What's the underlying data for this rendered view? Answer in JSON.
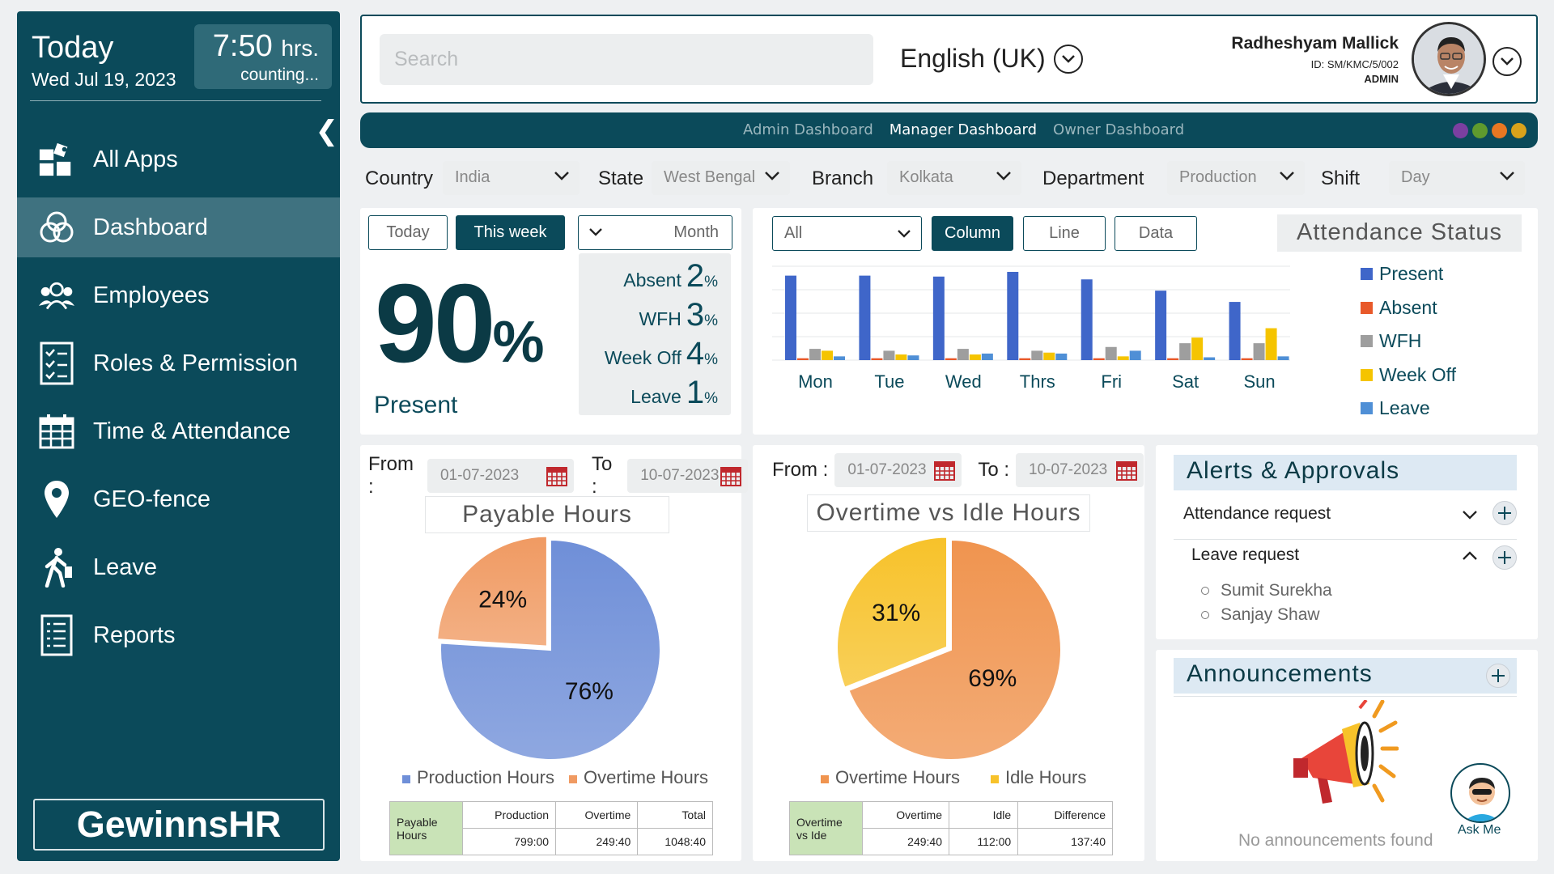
{
  "sidebar": {
    "today_title": "Today",
    "today_date": "Wed Jul 19, 2023",
    "time_value": "7:50",
    "time_unit": "hrs.",
    "time_status": "counting...",
    "collapse_icon": "chevron-left-icon",
    "items": [
      {
        "label": "All Apps",
        "icon": "apps-icon"
      },
      {
        "label": "Dashboard",
        "icon": "dashboard-icon"
      },
      {
        "label": "Employees",
        "icon": "employees-icon"
      },
      {
        "label": "Roles & Permission",
        "icon": "checklist-icon"
      },
      {
        "label": "Time & Attendance",
        "icon": "calendar-icon"
      },
      {
        "label": "GEO-fence",
        "icon": "location-pin-icon"
      },
      {
        "label": "Leave",
        "icon": "walking-person-icon"
      },
      {
        "label": "Reports",
        "icon": "report-icon"
      }
    ],
    "active_item": "Dashboard",
    "brand": "GewinnsHR"
  },
  "header": {
    "search_placeholder": "Search",
    "language": "English (UK)",
    "user_name": "Radheshyam Mallick",
    "user_id": "ID: SM/KMC/5/002",
    "user_role": "ADMIN"
  },
  "tabs": {
    "items": [
      "Admin Dashboard",
      "Manager Dashboard",
      "Owner Dashboard"
    ],
    "active": "Manager Dashboard",
    "theme_dots": [
      "#7b3fa0",
      "#5f9a2e",
      "#e87722",
      "#d9a21b"
    ]
  },
  "filters": {
    "country_label": "Country",
    "country_value": "India",
    "state_label": "State",
    "state_value": "West Bengal",
    "branch_label": "Branch",
    "branch_value": "Kolkata",
    "department_label": "Department",
    "department_value": "Production",
    "shift_label": "Shift",
    "shift_value": "Day"
  },
  "attendance_summary": {
    "btn_today": "Today",
    "btn_week": "This week",
    "btn_month": "Month",
    "present_value": "90",
    "present_unit": "%",
    "present_label": "Present",
    "absent_label": "Absent",
    "absent_value": "2",
    "wfh_label": "WFH",
    "wfh_value": "3",
    "weekoff_label": "Week Off",
    "weekoff_value": "4",
    "leave_label": "Leave",
    "leave_value": "1",
    "pct": "%"
  },
  "attendance_chart_controls": {
    "filter_value": "All",
    "btn_column": "Column",
    "btn_line": "Line",
    "btn_data": "Data",
    "title": "Attendance Status"
  },
  "chart_data": [
    {
      "type": "bar",
      "title": "Attendance Status",
      "categories": [
        "Mon",
        "Tue",
        "Wed",
        "Thrs",
        "Fri",
        "Sat",
        "Sun"
      ],
      "series": [
        {
          "name": "Present",
          "color": "#3f66c9",
          "values": [
            90,
            90,
            89,
            94,
            86,
            74,
            62
          ]
        },
        {
          "name": "Absent",
          "color": "#e8592a",
          "values": [
            2,
            2,
            2,
            2,
            2,
            2,
            2
          ]
        },
        {
          "name": "WFH",
          "color": "#9e9e9e",
          "values": [
            12,
            10,
            12,
            10,
            14,
            18,
            18
          ]
        },
        {
          "name": "Week Off",
          "color": "#f5c400",
          "values": [
            10,
            6,
            6,
            8,
            4,
            24,
            34
          ]
        },
        {
          "name": "Leave",
          "color": "#4f8fd6",
          "values": [
            4,
            5,
            7,
            7,
            10,
            3,
            4
          ]
        }
      ],
      "ylim": [
        0,
        100
      ],
      "grid": true,
      "legend": "right"
    },
    {
      "type": "pie",
      "title": "Payable Hours",
      "labels": [
        "Production Hours",
        "Overtime Hours"
      ],
      "values": [
        76,
        24
      ],
      "colors": [
        "#6f8fd8",
        "#f09a62"
      ]
    },
    {
      "type": "pie",
      "title": "Overtime vs Idle Hours",
      "labels": [
        "Overtime Hours",
        "Idle Hours"
      ],
      "values": [
        69,
        31
      ],
      "colors": [
        "#f0944f",
        "#f7c22a"
      ]
    }
  ],
  "payable": {
    "from_label": "From :",
    "from_value": "01-07-2023",
    "to_label": "To :",
    "to_value": "10-07-2023",
    "title": "Payable Hours",
    "legend": [
      "Production Hours",
      "Overtime Hours"
    ],
    "table": {
      "row_head": "Payable Hours",
      "headers": [
        "Production",
        "Overtime",
        "Total"
      ],
      "values": [
        "799:00",
        "249:40",
        "1048:40"
      ]
    }
  },
  "overtime": {
    "from_label": "From :",
    "from_value": "01-07-2023",
    "to_label": "To :",
    "to_value": "10-07-2023",
    "title": "Overtime vs Idle Hours",
    "legend": [
      "Overtime Hours",
      "Idle Hours"
    ],
    "table": {
      "row_head": "Overtime vs Ide",
      "headers": [
        "Overtime",
        "Idle",
        "Difference"
      ],
      "values": [
        "249:40",
        "112:00",
        "137:40"
      ]
    }
  },
  "alerts": {
    "title": "Alerts & Approvals",
    "rows": [
      "Attendance request",
      "Leave request"
    ],
    "leave_people": [
      "Sumit Surekha",
      "Sanjay Shaw"
    ]
  },
  "announcements": {
    "title": "Announcements",
    "empty_text": "No announcements found",
    "ask_me": "Ask Me"
  }
}
